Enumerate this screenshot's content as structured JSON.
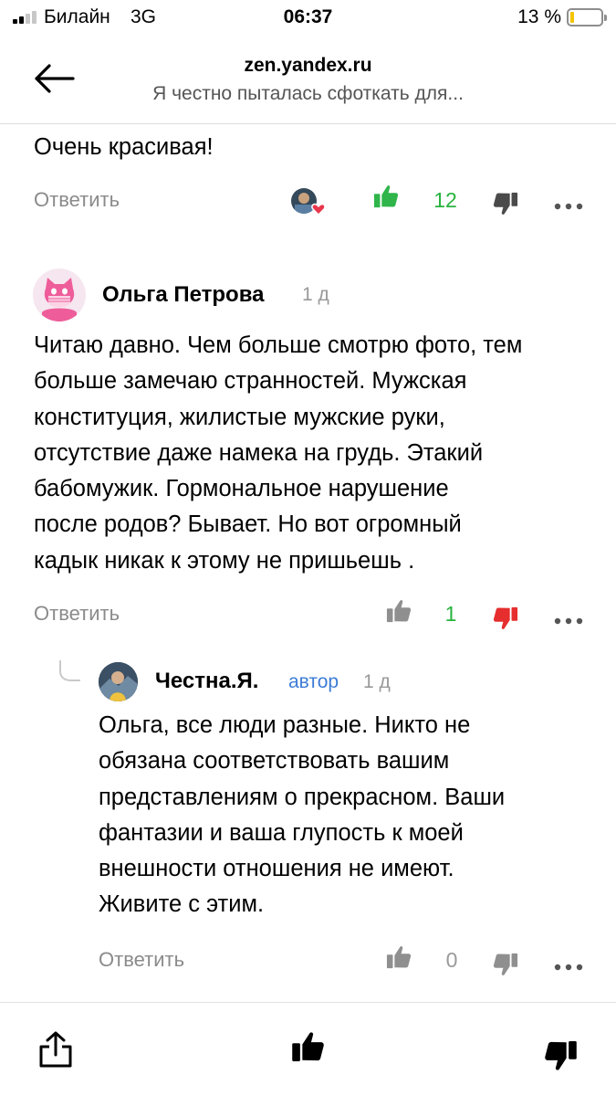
{
  "status_bar": {
    "carrier": "Билайн",
    "network": "3G",
    "time": "06:37",
    "battery_percent_label": "13 %",
    "battery_level": 0.13,
    "signal_bars_active": 2,
    "signal_bars_total": 4
  },
  "header": {
    "domain": "zen.yandex.ru",
    "title": "Я честно пыталась сфоткать для..."
  },
  "comments": [
    {
      "text": "Очень красивая!",
      "reply_label": "Ответить",
      "likes": "12",
      "liked": true
    },
    {
      "author": "Ольга Петрова",
      "time": "1 д",
      "lines": [
        "Читаю давно. Чем больше смотрю фото, тем",
        "больше замечаю странностей. Мужская",
        "конституция, жилистые мужские руки,",
        "отсутствие даже намека на грудь. Этакий",
        "бабомужик. Гормональное нарушение",
        "после родов? Бывает. Но вот огромный",
        "кадык никак к этому не пришьешь ."
      ],
      "reply_label": "Ответить",
      "likes": "1",
      "disliked": true
    },
    {
      "author": "Честна.Я.",
      "badge": "автор",
      "time": "1 д",
      "lines": [
        "Ольга, все люди разные. Никто не",
        "обязана соответствовать вашим",
        "представлениям о прекрасном. Ваши",
        "фантазии и ваша глупость к моей",
        "внешности отношения не имеют.",
        "Живите с этим."
      ],
      "reply_label": "Ответить",
      "likes": "0"
    }
  ],
  "bottom_bar": {
    "icons": [
      "share-icon",
      "like-icon",
      "dislike-icon"
    ]
  },
  "colors": {
    "like_active": "#2fb54a",
    "dislike_active": "#e62e2e",
    "icon_gray": "#8f8f8f",
    "icon_dark": "#4a4a4a",
    "author_badge": "#3d7cd6",
    "reply_link": "#8b8b8b"
  }
}
